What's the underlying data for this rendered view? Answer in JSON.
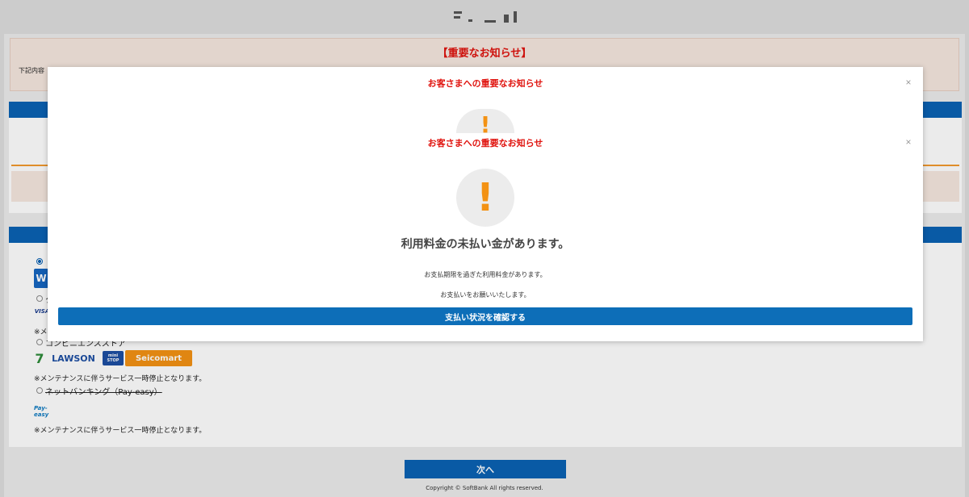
{
  "background": {
    "notice_title": "【重要なお知らせ】",
    "notice_text": "下記内容",
    "payment_methods": [
      {
        "label": "",
        "selected": true,
        "strikethrough": false
      },
      {
        "label": "ク",
        "selected": false,
        "strikethrough": false,
        "note": "※メン"
      },
      {
        "label": "コンビニエンスストア",
        "selected": false,
        "strikethrough": false,
        "note": "※メンテナンスに伴うサービス一時停止となります。"
      },
      {
        "label": "ネットバンキング（Pay-easy）",
        "selected": false,
        "strikethrough": true,
        "note": "※メンテナンスに伴うサービス一時停止となります。"
      }
    ],
    "logos": {
      "visa": "VISA",
      "lawson": "LAWSON",
      "ministop": "mini STOP",
      "seicomart": "Seicomart",
      "payeasy": "Pay-easy"
    },
    "next_button": "次へ",
    "copyright": "Copyright © SoftBank All rights reserved."
  },
  "modal": {
    "title_back": "お客さまへの重要なお知らせ",
    "title": "お客さまへの重要なお知らせ",
    "close_glyph": "×",
    "alert_glyph": "!",
    "heading": "利用料金の未払い金があります。",
    "line1": "お支払期限を過ぎた利用料金があります。",
    "line2": "お支払いをお願いいたします。",
    "confirm_button": "支払い状況を確認する"
  },
  "colors": {
    "accent_red": "#e0140f",
    "brand_blue": "#0a62b3",
    "alert_orange": "#f39214",
    "notice_bg": "#f6e8df"
  }
}
